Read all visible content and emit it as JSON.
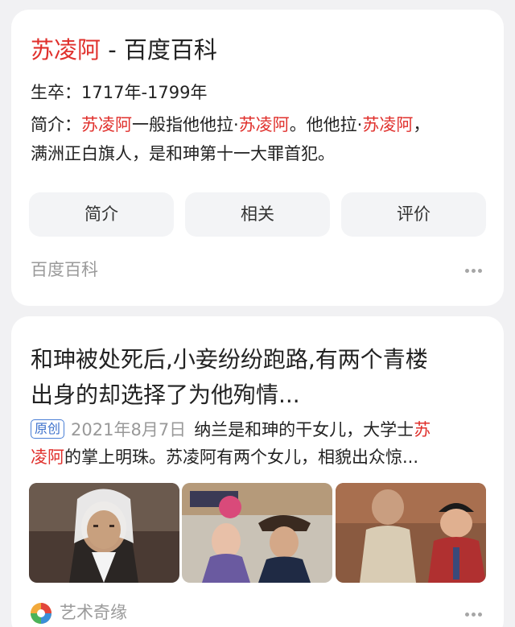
{
  "result1": {
    "title_highlight": "苏凌阿",
    "title_rest": " - 百度百科",
    "life_label": "生卒：",
    "life_value": "1717年-1799年",
    "intro_label": "简介：",
    "intro_hl1": "苏凌阿",
    "intro_t1": "一般指他他拉·",
    "intro_hl2": "苏凌阿",
    "intro_t2": "。他他拉·",
    "intro_hl3": "苏凌阿",
    "intro_t3": "，",
    "intro_line2": "满洲正白旗人，是和珅第十一大罪首犯。",
    "tabs": [
      "简介",
      "相关",
      "评价"
    ],
    "source": "百度百科"
  },
  "result2": {
    "title_line1": "和珅被处死后,小妾纷纷跑路,有两个青楼",
    "title_line2": "出身的却选择了为他殉情...",
    "badge": "原创",
    "date": "2021年8月7日",
    "snippet_t1": "纳兰是和珅的干女儿，大学士",
    "snippet_hl1": "苏",
    "snippet_hl2": "凌阿",
    "snippet_t2": "的掌上明珠。苏凌阿有两个女儿，相貌出众惊...",
    "author": "艺术奇缘"
  },
  "colors": {
    "highlight": "#e0302c",
    "badge": "#3b6fcb",
    "muted": "#9a9a9a"
  }
}
